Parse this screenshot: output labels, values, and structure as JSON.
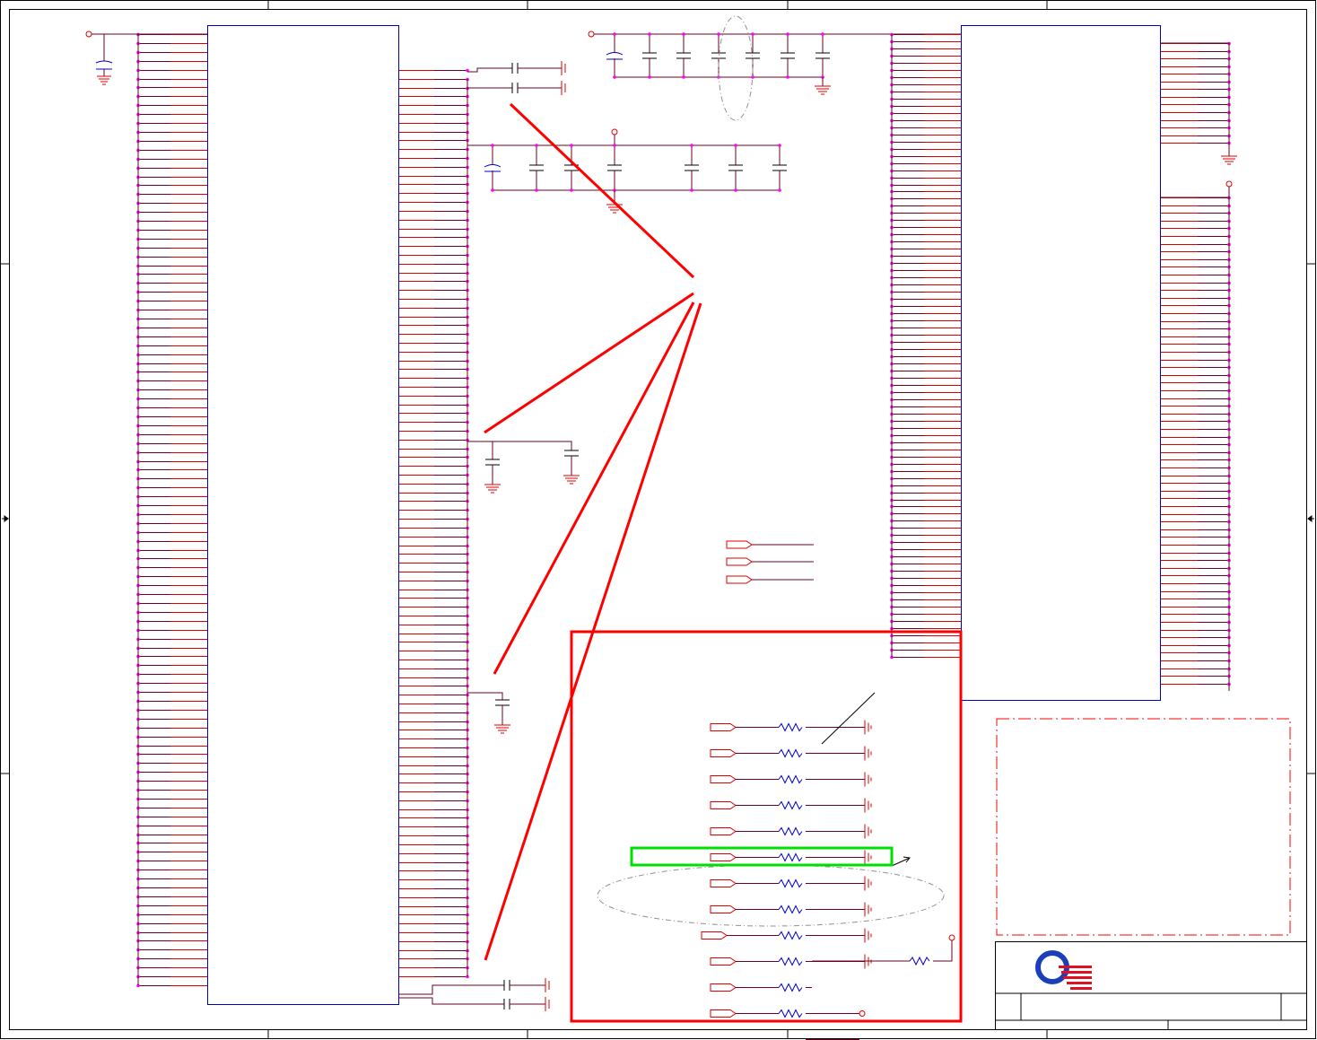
{
  "schematic": {
    "colors": {
      "wire": "#6b0020",
      "pin": "#e00000",
      "part_body": "#0000c0",
      "junction": "#ff00ff",
      "annotation": "#ff0000",
      "highlight": "#00e000",
      "note_outline": "#909090",
      "frame": "#000000"
    },
    "left_chip": {
      "pin_count_left": 108,
      "pin_count_right": 104
    },
    "right_chip": {
      "pin_count_left": 88,
      "pin_count_right": 88
    },
    "resistor_rows": 12,
    "logo": {
      "icon": "q-logo-icon"
    }
  }
}
